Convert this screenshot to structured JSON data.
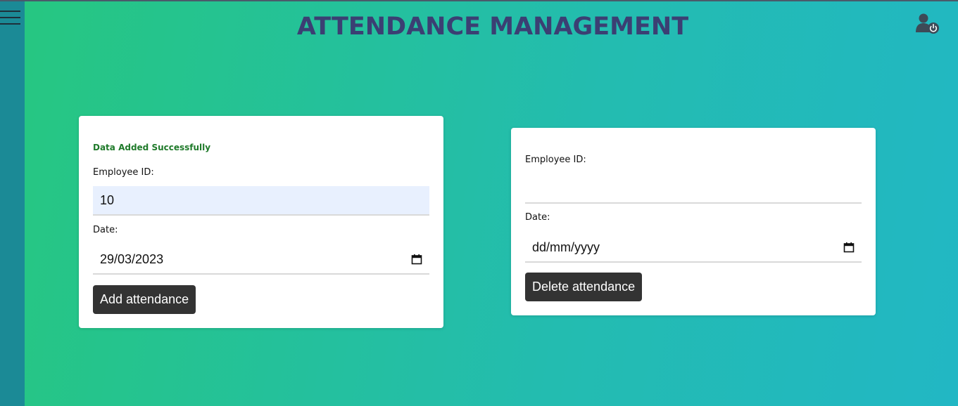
{
  "header": {
    "title": "ATTENDANCE MANAGEMENT",
    "menu_icon": "hamburger-menu-icon",
    "user_icon": "user-logout-icon"
  },
  "add_form": {
    "message": "Data Added Successfully",
    "employee_label": "Employee ID:",
    "employee_value": "10",
    "date_label": "Date:",
    "date_value": "29/03/2023",
    "button": "Add attendance"
  },
  "delete_form": {
    "employee_label": "Employee ID:",
    "employee_value": "",
    "date_label": "Date:",
    "date_placeholder": "dd/mm/yyyy",
    "button": "Delete attendance"
  },
  "colors": {
    "gradient_start": "#26c77f",
    "gradient_end": "#22b7c4",
    "sidebar": "#1b8a96",
    "title": "#3b3f73",
    "success": "#1f7a2a",
    "button_bg": "#333333",
    "autofill_bg": "#e8f0fe"
  }
}
